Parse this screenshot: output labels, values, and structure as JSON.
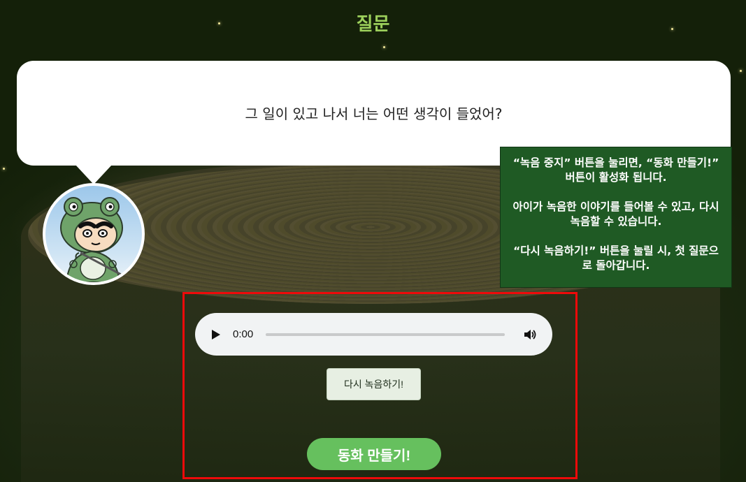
{
  "page": {
    "title": "질문"
  },
  "question": {
    "text": "그 일이 있고 나서 너는 어떤 생각이 들었어?"
  },
  "hint": {
    "line1": "“녹음 중지” 버튼을 눌리면, “동화 만들기!” 버튼이 활성화 됩니다.",
    "line2": "아이가 녹음한 이야기를 들어볼 수 있고, 다시 녹음할 수 있습니다.",
    "line3": "“다시 녹음하기!” 버튼을 눌릴 시, 첫 질문으로 돌아갑니다."
  },
  "audio": {
    "time": "0:00",
    "progress": 0
  },
  "buttons": {
    "rerecord": "다시 녹음하기!",
    "make_story": "동화 만들기!"
  },
  "colors": {
    "title": "#9ccf5b",
    "hint_bg": "#1f5a24",
    "primary_button": "#66c05e",
    "highlight_frame": "#ee0a0a"
  },
  "icons": {
    "play": "play-icon",
    "volume": "volume-icon",
    "avatar": "frog-costume-character"
  }
}
